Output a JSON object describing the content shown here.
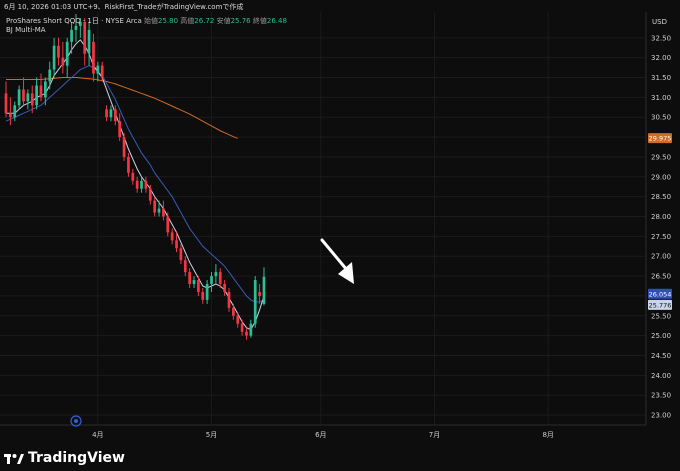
{
  "header": {
    "text": "6月 10, 2026 01:03 UTC+9、RiskFirst_TradeがTradingView.comで作成"
  },
  "legend": {
    "name": "ProShares Short QQQ · 1日 · NYSE Arca",
    "open_label": "始値",
    "open": "25.80",
    "high_label": "高値",
    "high": "26.72",
    "low_label": "安値",
    "low": "25.76",
    "close_label": "終値",
    "close": "26.48",
    "indicator": "BJ Multi-MA"
  },
  "currency": "USD",
  "brand": {
    "text": "TradingView"
  },
  "colors": {
    "up": "#2bbf95",
    "down": "#f23645",
    "ma_fast": "#c9d6e8",
    "ma_mid": "#3b5bb5",
    "ma_slow": "#d26a24",
    "bg": "#0d0d0d"
  },
  "chart_data": {
    "type": "candlestick",
    "ylim": [
      22.8,
      33.1
    ],
    "ytick_values": [
      23.0,
      23.5,
      24.0,
      24.5,
      25.0,
      25.5,
      26.0,
      26.5,
      27.0,
      27.5,
      28.0,
      28.5,
      29.0,
      29.5,
      30.0,
      30.5,
      31.0,
      31.5,
      32.0,
      32.5
    ],
    "ytick_labels": [
      "23.00",
      "23.50",
      "24.00",
      "24.50",
      "25.00",
      "25.50",
      "26.00",
      "26.50",
      "27.00",
      "27.50",
      "28.00",
      "28.50",
      "29.00",
      "29.50",
      "30.00",
      "30.50",
      "31.00",
      "31.50",
      "32.00",
      "32.50"
    ],
    "xtick_labels": [
      "4月",
      "5月",
      "6月",
      "7月",
      "8月"
    ],
    "xtick_index": [
      21,
      47,
      72,
      98,
      124
    ],
    "x_span": [
      0,
      145
    ],
    "candles": [
      {
        "o": 31.1,
        "h": 31.4,
        "l": 30.5,
        "c": 30.6
      },
      {
        "o": 30.6,
        "h": 31.0,
        "l": 30.3,
        "c": 30.5
      },
      {
        "o": 30.5,
        "h": 30.9,
        "l": 30.4,
        "c": 30.8
      },
      {
        "o": 30.8,
        "h": 31.3,
        "l": 30.7,
        "c": 31.2
      },
      {
        "o": 31.2,
        "h": 31.5,
        "l": 30.8,
        "c": 30.9
      },
      {
        "o": 30.9,
        "h": 31.2,
        "l": 30.7,
        "c": 31.1
      },
      {
        "o": 31.1,
        "h": 31.3,
        "l": 30.6,
        "c": 30.8
      },
      {
        "o": 30.8,
        "h": 31.5,
        "l": 30.7,
        "c": 31.3
      },
      {
        "o": 31.3,
        "h": 31.6,
        "l": 30.9,
        "c": 31.0
      },
      {
        "o": 31.0,
        "h": 31.5,
        "l": 30.8,
        "c": 31.4
      },
      {
        "o": 31.4,
        "h": 31.9,
        "l": 31.2,
        "c": 31.7
      },
      {
        "o": 31.7,
        "h": 32.5,
        "l": 31.5,
        "c": 32.3
      },
      {
        "o": 32.3,
        "h": 32.5,
        "l": 31.8,
        "c": 32.0
      },
      {
        "o": 32.0,
        "h": 32.4,
        "l": 31.6,
        "c": 31.8
      },
      {
        "o": 31.8,
        "h": 32.5,
        "l": 31.5,
        "c": 32.4
      },
      {
        "o": 32.4,
        "h": 32.9,
        "l": 32.1,
        "c": 32.7
      },
      {
        "o": 32.7,
        "h": 33.1,
        "l": 32.4,
        "c": 32.8
      },
      {
        "o": 32.8,
        "h": 33.0,
        "l": 32.5,
        "c": 32.9
      },
      {
        "o": 32.9,
        "h": 33.0,
        "l": 31.8,
        "c": 32.1
      },
      {
        "o": 32.1,
        "h": 32.9,
        "l": 31.8,
        "c": 32.7
      },
      {
        "o": 32.4,
        "h": 32.6,
        "l": 31.4,
        "c": 31.6
      },
      {
        "o": 31.6,
        "h": 31.9,
        "l": 31.4,
        "c": 31.8
      },
      {
        "o": 31.8,
        "h": 31.9,
        "l": 31.4,
        "c": 31.5
      },
      {
        "o": 30.7,
        "h": 30.8,
        "l": 30.4,
        "c": 30.5
      },
      {
        "o": 30.5,
        "h": 30.8,
        "l": 30.4,
        "c": 30.7
      },
      {
        "o": 30.7,
        "h": 30.8,
        "l": 30.3,
        "c": 30.4
      },
      {
        "o": 30.4,
        "h": 30.6,
        "l": 29.9,
        "c": 30.0
      },
      {
        "o": 30.0,
        "h": 30.1,
        "l": 29.4,
        "c": 29.5
      },
      {
        "o": 29.5,
        "h": 29.6,
        "l": 29.0,
        "c": 29.1
      },
      {
        "o": 29.1,
        "h": 29.2,
        "l": 28.8,
        "c": 28.9
      },
      {
        "o": 28.9,
        "h": 29.0,
        "l": 28.6,
        "c": 28.7
      },
      {
        "o": 28.7,
        "h": 29.0,
        "l": 28.6,
        "c": 28.9
      },
      {
        "o": 28.9,
        "h": 29.0,
        "l": 28.6,
        "c": 28.7
      },
      {
        "o": 28.7,
        "h": 28.8,
        "l": 28.3,
        "c": 28.4
      },
      {
        "o": 28.4,
        "h": 28.5,
        "l": 28.0,
        "c": 28.1
      },
      {
        "o": 28.1,
        "h": 28.4,
        "l": 28.0,
        "c": 28.2
      },
      {
        "o": 28.2,
        "h": 28.4,
        "l": 27.9,
        "c": 28.0
      },
      {
        "o": 28.0,
        "h": 28.1,
        "l": 27.5,
        "c": 27.6
      },
      {
        "o": 27.6,
        "h": 27.7,
        "l": 27.3,
        "c": 27.4
      },
      {
        "o": 27.4,
        "h": 27.6,
        "l": 27.1,
        "c": 27.2
      },
      {
        "o": 27.2,
        "h": 27.3,
        "l": 26.8,
        "c": 26.9
      },
      {
        "o": 26.9,
        "h": 27.0,
        "l": 26.5,
        "c": 26.6
      },
      {
        "o": 26.6,
        "h": 26.7,
        "l": 26.2,
        "c": 26.3
      },
      {
        "o": 26.3,
        "h": 26.5,
        "l": 26.2,
        "c": 26.4
      },
      {
        "o": 26.4,
        "h": 26.5,
        "l": 26.0,
        "c": 26.1
      },
      {
        "o": 26.1,
        "h": 26.2,
        "l": 25.8,
        "c": 25.9
      },
      {
        "o": 25.9,
        "h": 26.4,
        "l": 25.8,
        "c": 26.3
      },
      {
        "o": 26.3,
        "h": 26.6,
        "l": 26.1,
        "c": 26.5
      },
      {
        "o": 26.5,
        "h": 26.8,
        "l": 26.3,
        "c": 26.6
      },
      {
        "o": 26.6,
        "h": 26.7,
        "l": 26.2,
        "c": 26.3
      },
      {
        "o": 26.3,
        "h": 26.4,
        "l": 26.0,
        "c": 26.1
      },
      {
        "o": 26.1,
        "h": 26.2,
        "l": 25.6,
        "c": 25.7
      },
      {
        "o": 25.7,
        "h": 25.8,
        "l": 25.4,
        "c": 25.5
      },
      {
        "o": 25.5,
        "h": 25.6,
        "l": 25.2,
        "c": 25.3
      },
      {
        "o": 25.3,
        "h": 25.4,
        "l": 25.0,
        "c": 25.1
      },
      {
        "o": 25.1,
        "h": 25.2,
        "l": 24.9,
        "c": 25.0
      },
      {
        "o": 25.0,
        "h": 25.4,
        "l": 24.95,
        "c": 25.3
      },
      {
        "o": 25.3,
        "h": 26.5,
        "l": 25.2,
        "c": 26.4
      },
      {
        "o": 26.1,
        "h": 26.3,
        "l": 25.8,
        "c": 26.0
      },
      {
        "o": 25.8,
        "h": 26.72,
        "l": 25.76,
        "c": 26.48
      }
    ],
    "candle_index": [
      0,
      1,
      2,
      3,
      4,
      5,
      6,
      7,
      8,
      9,
      10,
      11,
      12,
      13,
      14,
      15,
      16,
      17,
      18,
      19,
      20,
      21,
      22,
      23,
      24,
      25,
      26,
      27,
      28,
      29,
      30,
      31,
      32,
      33,
      34,
      35,
      36,
      37,
      38,
      39,
      40,
      41,
      42,
      43,
      44,
      45,
      46,
      47,
      48,
      49,
      50,
      51,
      52,
      53,
      54,
      55,
      56,
      57,
      58,
      59
    ],
    "ma_fast": [
      30.6,
      30.6,
      30.6,
      30.7,
      30.8,
      30.85,
      30.9,
      31.0,
      31.05,
      31.1,
      31.3,
      31.55,
      31.7,
      31.85,
      32.0,
      32.2,
      32.35,
      32.45,
      32.3,
      32.1,
      31.8,
      31.65,
      31.5,
      31.2,
      30.9,
      30.6,
      30.3,
      30.0,
      29.7,
      29.45,
      29.2,
      29.0,
      28.85,
      28.7,
      28.5,
      28.35,
      28.2,
      28.0,
      27.8,
      27.6,
      27.35,
      27.1,
      26.85,
      26.65,
      26.45,
      26.25,
      26.2,
      26.25,
      26.3,
      26.25,
      26.15,
      25.95,
      25.75,
      25.55,
      25.35,
      25.2,
      25.15,
      25.35,
      25.65,
      26.0
    ],
    "ma_mid": [
      30.4,
      30.45,
      30.5,
      30.55,
      30.6,
      30.65,
      30.7,
      30.75,
      30.8,
      30.9,
      31.0,
      31.1,
      31.2,
      31.3,
      31.4,
      31.5,
      31.6,
      31.7,
      31.75,
      31.8,
      31.75,
      31.65,
      31.55,
      31.35,
      31.15,
      30.95,
      30.7,
      30.45,
      30.2,
      30.0,
      29.8,
      29.6,
      29.45,
      29.3,
      29.1,
      28.95,
      28.8,
      28.65,
      28.5,
      28.3,
      28.1,
      27.9,
      27.7,
      27.55,
      27.4,
      27.25,
      27.15,
      27.05,
      26.95,
      26.85,
      26.75,
      26.6,
      26.45,
      26.3,
      26.15,
      26.0,
      25.9,
      25.85,
      25.85,
      25.9
    ],
    "ma_slow": [
      31.45,
      31.45,
      31.45,
      31.45,
      31.45,
      31.45,
      31.45,
      31.45,
      31.45,
      31.46,
      31.47,
      31.48,
      31.49,
      31.5,
      31.5,
      31.5,
      31.5,
      31.49,
      31.48,
      31.47,
      31.46,
      31.44,
      31.42,
      31.4,
      31.37,
      31.34,
      31.3,
      31.26,
      31.22,
      31.18,
      31.14,
      31.1,
      31.06,
      31.02,
      30.98,
      30.93,
      30.88,
      30.83,
      30.78,
      30.73,
      30.68,
      30.63,
      30.58,
      30.52,
      30.46,
      30.4,
      30.34,
      30.28,
      30.22,
      30.16,
      30.11,
      30.06,
      30.01,
      29.97
    ],
    "last_price_labels": [
      {
        "text": "29.975",
        "value": 29.975,
        "color": "#d26a24"
      },
      {
        "text": "26.054",
        "value": 26.054,
        "color": "#2f4fb8"
      },
      {
        "text": "25.776",
        "value": 25.776,
        "color": "#c9d6e8"
      }
    ]
  }
}
